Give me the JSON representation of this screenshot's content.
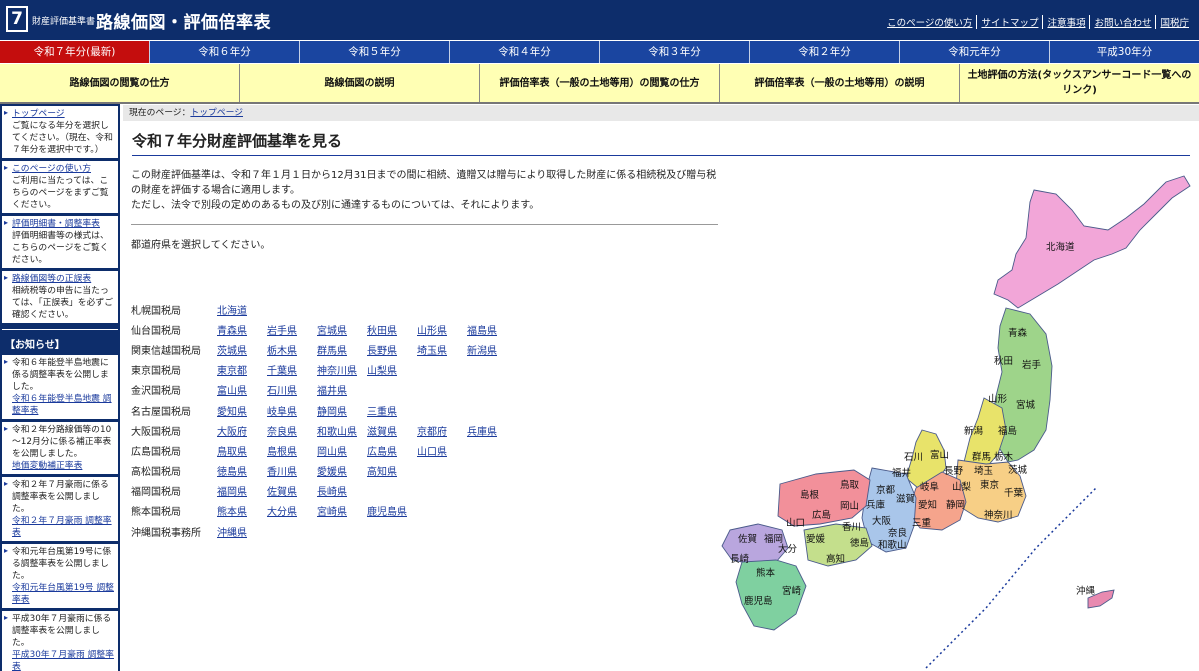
{
  "header": {
    "logo_glyph": "7",
    "site_small": "財産評価基準書",
    "site_title": "路線価図・評価倍率表",
    "links": [
      "このページの使い方",
      "サイトマップ",
      "注意事項",
      "お問い合わせ",
      "国税庁"
    ]
  },
  "year_tabs": [
    "令和７年分(最新)",
    "令和６年分",
    "令和５年分",
    "令和４年分",
    "令和３年分",
    "令和２年分",
    "令和元年分",
    "平成30年分"
  ],
  "yellow_menu": [
    "路線価図の閲覧の仕方",
    "路線価図の説明",
    "評価倍率表（一般の土地等用）の閲覧の仕方",
    "評価倍率表（一般の土地等用）の説明",
    "土地評価の方法(タックスアンサーコード一覧へのリンク)"
  ],
  "sidebar": {
    "boxes": [
      {
        "link": "トップページ",
        "text": "ご覧になる年分を選択してください。（現在、令和７年分を選択中です。）"
      },
      {
        "link": "このページの使い方",
        "text": "ご利用に当たっては、こちらのページをまずご覧ください。"
      },
      {
        "link": "評価明細書・調整率表",
        "text": "評価明細書等の様式は、こちらのページをご覧ください。"
      },
      {
        "link": "路線価図等の正誤表",
        "text": "相続税等の申告に当たっては、「正誤表」を必ずご確認ください。"
      }
    ],
    "notice_heading": "【お知らせ】",
    "notices": [
      {
        "text": "令和６年能登半島地震に係る調整率表を公開しました。",
        "link": "令和６年能登半島地震 調整率表"
      },
      {
        "text": "令和２年分路線価等の10～12月分に係る補正率表を公開しました。",
        "link": "地価変動補正率表"
      },
      {
        "text": "令和２年７月豪雨に係る調整率表を公開しました。",
        "link": "令和２年７月豪雨 調整率表"
      },
      {
        "text": "令和元年台風第19号に係る調整率表を公開しました。",
        "link": "令和元年台風第19号 調整率表"
      },
      {
        "text": "平成30年７月豪雨に係る調整率表を公開しました。",
        "link": "平成30年７月豪雨 調整率表"
      }
    ]
  },
  "breadcrumb": {
    "prefix": "現在のページ：",
    "link": "トップページ"
  },
  "page_title": "令和７年分財産評価基準を見る",
  "intro": [
    "この財産評価基準は、令和７年１月１日から12月31日までの間に相続、遺贈又は贈与により取得した財産に係る相続税及び贈与税の財産を評価する場合に適用します。",
    "ただし、法令で別段の定めのあるもの及び別に通達するものについては、それによります。"
  ],
  "select_prompt": "都道府県を選択してください。",
  "bureaus": [
    {
      "name": "札幌国税局",
      "prefs": [
        "北海道"
      ]
    },
    {
      "name": "仙台国税局",
      "prefs": [
        "青森県",
        "岩手県",
        "宮城県",
        "秋田県",
        "山形県",
        "福島県"
      ]
    },
    {
      "name": "関東信越国税局",
      "prefs": [
        "茨城県",
        "栃木県",
        "群馬県",
        "長野県",
        "埼玉県",
        "新潟県"
      ]
    },
    {
      "name": "東京国税局",
      "prefs": [
        "東京都",
        "千葉県",
        "神奈川県",
        "山梨県"
      ]
    },
    {
      "name": "金沢国税局",
      "prefs": [
        "富山県",
        "石川県",
        "福井県"
      ]
    },
    {
      "name": "名古屋国税局",
      "prefs": [
        "愛知県",
        "岐阜県",
        "静岡県",
        "三重県"
      ]
    },
    {
      "name": "大阪国税局",
      "prefs": [
        "大阪府",
        "奈良県",
        "和歌山県",
        "滋賀県",
        "京都府",
        "兵庫県"
      ]
    },
    {
      "name": "広島国税局",
      "prefs": [
        "鳥取県",
        "島根県",
        "岡山県",
        "広島県",
        "山口県"
      ]
    },
    {
      "name": "高松国税局",
      "prefs": [
        "徳島県",
        "香川県",
        "愛媛県",
        "高知県"
      ]
    },
    {
      "name": "福岡国税局",
      "prefs": [
        "福岡県",
        "佐賀県",
        "長崎県"
      ]
    },
    {
      "name": "熊本国税局",
      "prefs": [
        "熊本県",
        "大分県",
        "宮崎県",
        "鹿児島県"
      ]
    },
    {
      "name": "沖縄国税事務所",
      "prefs": [
        "沖縄県"
      ]
    }
  ],
  "map_labels": {
    "hokkaido": "北海道",
    "aomori": "青森",
    "akita": "秋田",
    "iwate": "岩手",
    "yamagata": "山形",
    "miyagi": "宮城",
    "niigata": "新潟",
    "fukushima": "福島",
    "ishikawa": "石川",
    "toyama": "富山",
    "gunma": "群馬",
    "tochigi": "栃木",
    "ibaraki": "茨城",
    "fukui": "福井",
    "nagano": "長野",
    "saitama": "埼玉",
    "tottori": "鳥取",
    "kyoto": "京都",
    "gifu": "岐阜",
    "yamanashi": "山梨",
    "tokyo": "東京",
    "chiba": "千葉",
    "shimane": "島根",
    "okayama": "岡山",
    "hyogo": "兵庫",
    "shiga": "滋賀",
    "hiroshima": "広島",
    "osaka": "大阪",
    "aichi": "愛知",
    "shizuoka": "静岡",
    "kanagawa": "神奈川",
    "yamaguchi": "山口",
    "kagawa": "香川",
    "nara": "奈良",
    "mie": "三重",
    "saga": "佐賀",
    "fukuoka": "福岡",
    "ehime": "愛媛",
    "tokushima": "徳島",
    "wakayama": "和歌山",
    "oita": "大分",
    "nagasaki": "長崎",
    "kochi": "高知",
    "kumamoto": "熊本",
    "miyazaki": "宮崎",
    "kagoshima": "鹿児島",
    "okinawa": "沖縄"
  },
  "map_colors": {
    "hokkaido": "#f2a6d8",
    "tohoku": "#9ed48a",
    "kanto": "#f7cf86",
    "hokuriku": "#e8e36a",
    "chubu": "#f5a48c",
    "kinki": "#a9c6ea",
    "chugoku": "#f2909a",
    "shikoku": "#c4df8c",
    "kyushu_n": "#b9a6de",
    "kyushu_s": "#7fd0a0",
    "okinawa": "#e88ab0"
  }
}
